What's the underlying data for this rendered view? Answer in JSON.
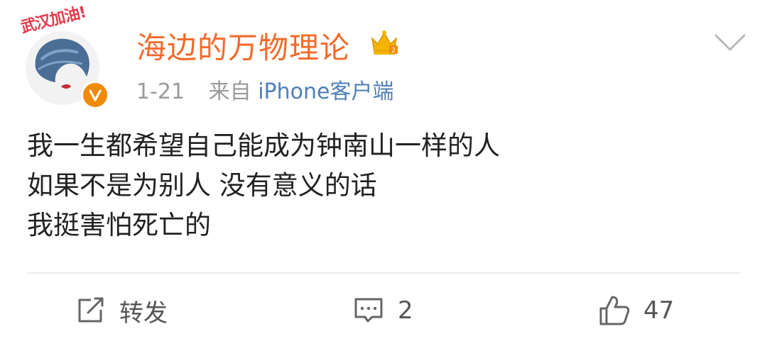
{
  "post": {
    "avatar_badge_text": "武汉加油!",
    "username": "海边的万物理论",
    "time": "1-21",
    "source_prefix": "来自",
    "source_link": "iPhone客户端",
    "content_lines": [
      "我一生都希望自己能成为钟南山一样的人",
      "如果不是为别人 没有意义的话",
      "我挺害怕死亡的"
    ]
  },
  "actions": {
    "repost_label": "转发",
    "comment_count": "2",
    "like_count": "47"
  },
  "colors": {
    "username": "#f26b2b",
    "source_link": "#4f7fb8",
    "meta": "#9a9a9a",
    "vip_badge": "#f08a00",
    "crown": "#f5b400"
  },
  "icons": {
    "crown": "crown-icon",
    "vip": "vip-badge-icon",
    "menu": "chevron-down-icon",
    "repost": "repost-icon",
    "comment": "comment-icon",
    "like": "thumbs-up-icon"
  }
}
